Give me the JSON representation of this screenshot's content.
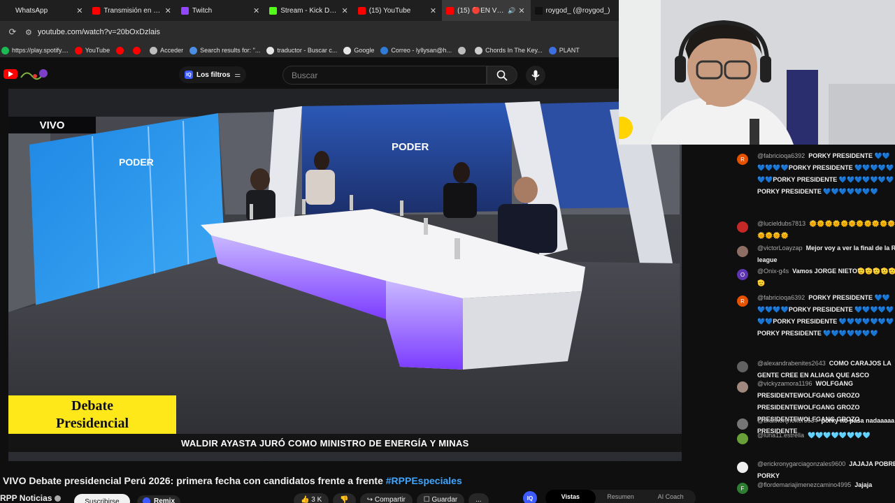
{
  "browser": {
    "tabs": [
      {
        "label": "WhatsApp",
        "favicon_color": "#1f1f1f"
      },
      {
        "label": "Transmisión en vivo",
        "favicon_color": "#ff0000"
      },
      {
        "label": "Twitch",
        "favicon_color": "#9146ff"
      },
      {
        "label": "Stream - Kick Dashbo",
        "favicon_color": "#53fc18"
      },
      {
        "label": "(15) YouTube",
        "favicon_color": "#ff0000"
      },
      {
        "label": "(15) 🔴EN VIVO |",
        "favicon_color": "#ff0000",
        "active": true
      },
      {
        "label": "roygod_ (@roygod_)",
        "favicon_color": "#111111"
      }
    ],
    "url": "youtube.com/watch?v=20bOxDzlais",
    "bookmarks": [
      {
        "label": "https://play.spotify....",
        "color": "#1db954"
      },
      {
        "label": "YouTube",
        "color": "#ff0000"
      },
      {
        "label": "",
        "color": "#ff0000"
      },
      {
        "label": "",
        "color": "#ff0000"
      },
      {
        "label": "Acceder",
        "color": "#bdbdbd"
      },
      {
        "label": "Search results for: \"...",
        "color": "#4a8ee6"
      },
      {
        "label": "traductor - Buscar c...",
        "color": "#e6e6e6"
      },
      {
        "label": "Google",
        "color": "#e6e6e6"
      },
      {
        "label": "Correo - lyllysan@h...",
        "color": "#2f7bd6"
      },
      {
        "label": "",
        "color": "#bdbdbd"
      },
      {
        "label": "Chords In The Key...",
        "color": "#cfcfcf"
      },
      {
        "label": "PLANT",
        "color": "#3d6fe0"
      }
    ]
  },
  "youtube": {
    "filter_label": "Los filtros",
    "search_placeholder": "Buscar"
  },
  "video": {
    "live_badge": "VIVO",
    "lower_third_line1": "Debate",
    "lower_third_line2": "Presidencial",
    "ticker": "WALDIR AYASTA JURÓ COMO MINISTRO DE ENERGÍA Y MINAS",
    "title_main": "VIVO Debate presidencial Perú 2026: primera fecha con candidatos frente a frente",
    "title_tag": "#RPPEspeciales",
    "channel": "RPP Noticias",
    "subscribe": "Suscribirse",
    "remix": "Remix",
    "likes": "3 K",
    "share": "Compartir",
    "save": "Guardar",
    "more": "...",
    "iq_badge": "IQ",
    "segments": [
      "Vistas",
      "Resumen",
      "AI Coach"
    ]
  },
  "chat": {
    "messages": [
      {
        "author": "@fabricioqa6392",
        "text": "PORKY PRESIDENTE 💙💙💙💙💙💙PORKY PRESIDENTE 💙💙💙💙💙💙💙PORKY PRESIDENTE 💙💙💙💙💙💙💙PORKY PRESIDENTE 💙💙💙💙💙💙💙",
        "avatar": "R",
        "avatar_color": "#e65100"
      },
      {
        "author": "@lucieldubs7813",
        "text": "🌞🌞🌞🌞🌞🌞🌞🌞🌞🌞🌞🌞🌞🌞🌞",
        "avatar": "",
        "avatar_color": "#c62828"
      },
      {
        "author": "@victorLoayzap",
        "text": "Mejor voy a ver la final de la R league",
        "avatar": "",
        "avatar_color": "#8d6e63"
      },
      {
        "author": "@Onix-g4s",
        "text": "Vamos JORGE NIETO🫡🫡🫡🫡🫡🫡",
        "avatar": "O",
        "avatar_color": "#5e35b1"
      },
      {
        "author": "@fabricioqa6392",
        "text": "PORKY PRESIDENTE 💙💙💙💙💙💙PORKY PRESIDENTE 💙💙💙💙💙💙💙PORKY PRESIDENTE 💙💙💙💙💙💙💙PORKY PRESIDENTE 💙💙💙💙💙💙💙",
        "avatar": "R",
        "avatar_color": "#e65100"
      },
      {
        "author": "@alexandrabenites2643",
        "text": "COMO CARAJOS LA GENTE CREE EN ALIAGA QUE ASCO",
        "avatar": "",
        "avatar_color": "#616161"
      },
      {
        "author": "@vickyzamora1196",
        "text": "WOLFGANG PRESIDENTEWOLFGANG GROZO PRESIDENTEWOLFGANG GROZO PRESIDENTEWOLFGANG GROZO PRESIDENTE",
        "avatar": "",
        "avatar_color": "#a1887f"
      },
      {
        "author": "@braithonjheffer6634",
        "text": "porky no pasa nadaaaaa",
        "avatar": "",
        "avatar_color": "#757575"
      },
      {
        "author": "@luna11.estrella",
        "text": "🩵🩵🩵🩵🩵🩵🩵🩵",
        "avatar": "",
        "avatar_color": "#689f38"
      },
      {
        "author": "@erickronygarciagonzales9600",
        "text": "JAJAJA POBRE PORKY",
        "avatar": "",
        "avatar_color": "#eeeeee"
      },
      {
        "author": "@flordemariajimenezcamino4995",
        "text": "Jajaja",
        "avatar": "F",
        "avatar_color": "#2e7d32"
      }
    ]
  }
}
